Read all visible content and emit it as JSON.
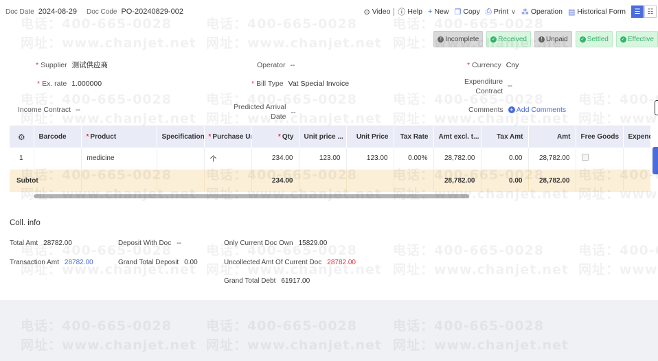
{
  "header": {
    "doc_date_label": "Doc Date",
    "doc_date": "2024-08-29",
    "doc_code_label": "Doc Code",
    "doc_code": "PO-20240829-002",
    "actions": {
      "video": "Video",
      "help": "Help",
      "new": "New",
      "copy": "Copy",
      "print": "Print",
      "operation": "Operation",
      "historical_form": "Historical Form"
    }
  },
  "statuses": [
    {
      "label": "Incomplete",
      "style": "grey"
    },
    {
      "label": "Received",
      "style": "green"
    },
    {
      "label": "Unpaid",
      "style": "grey"
    },
    {
      "label": "Settled",
      "style": "green"
    },
    {
      "label": "Effective",
      "style": "green"
    }
  ],
  "form": {
    "supplier": {
      "label": "Supplier",
      "value": "测试供应商"
    },
    "operator": {
      "label": "Operator",
      "value": "--"
    },
    "currency": {
      "label": "Currency",
      "value": "Cny"
    },
    "ex_rate": {
      "label": "Ex. rate",
      "value": "1.000000"
    },
    "bill_type": {
      "label": "Bill Type",
      "value": "Vat Special Invoice"
    },
    "expenditure_contract": {
      "label_line1": "Expenditure",
      "label_line2": "Contract",
      "value": "--"
    },
    "income_contract": {
      "label": "Income Contract",
      "value": "--"
    },
    "predicted_arrival_date": {
      "label_line1": "Predicted Arrival",
      "label_line2": "Date",
      "value": "--"
    },
    "comments": {
      "label": "Comments",
      "add_label": "Add Comments"
    }
  },
  "table": {
    "columns": [
      "Barcode",
      "Product",
      "Specification ...",
      "Purchase Unit",
      "Qty",
      "Unit price ...",
      "Unit Price",
      "Tax Rate",
      "Amt excl. t...",
      "Tax Amt",
      "Amt",
      "Free Goods",
      "Expendi"
    ],
    "rows": [
      {
        "index": "1",
        "barcode": "",
        "product": "medicine",
        "spec": "",
        "unit": "个",
        "qty": "234.00",
        "unit_price_tax": "123.00",
        "unit_price": "123.00",
        "tax_rate": "0.00%",
        "amt_excl": "28,782.00",
        "tax_amt": "0.00",
        "amt": "28,782.00"
      }
    ],
    "subtotal": {
      "label": "Subtot",
      "qty": "234.00",
      "amt_excl": "28,782.00",
      "tax_amt": "0.00",
      "amt": "28,782.00"
    }
  },
  "coll_info": {
    "title": "Coll. info",
    "total_amt": {
      "label": "Total Amt",
      "value": "28782.00"
    },
    "transaction_amt": {
      "label": "Transaction Amt",
      "value": "28782.00"
    },
    "deposit_with_doc": {
      "label": "Deposit With Doc",
      "value": "--"
    },
    "grand_total_deposit": {
      "label": "Grand Total Deposit",
      "value": "0.00"
    },
    "only_current_doc_own": {
      "label": "Only Current Doc Own",
      "value": "15829.00"
    },
    "uncollected_amt": {
      "label": "Uncollected Amt Of Current Doc",
      "value": "28782.00"
    },
    "grand_total_debt": {
      "label": "Grand Total Debt",
      "value": "61917.00"
    }
  },
  "watermark": {
    "phone": "电话：400-665-0028",
    "site": "网址：www.chanjet.net"
  },
  "colors": {
    "accent": "#4a6cdc",
    "required": "#e0323e",
    "subtotal_bg": "#fbefd7",
    "header_bg": "#e9ecf7",
    "status_green": "#34b36a"
  }
}
